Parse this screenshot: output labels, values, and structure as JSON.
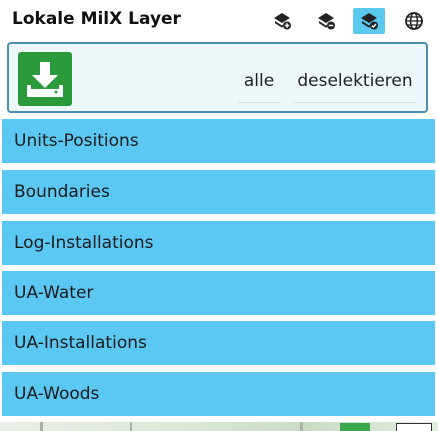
{
  "header": {
    "title": "Lokale MilX Layer",
    "icons": [
      "layers-add-icon",
      "layers-remove-icon",
      "layers-select-icon",
      "globe-icon"
    ],
    "active_icon": "layers-select-icon"
  },
  "toolbar": {
    "download_icon": "download-icon",
    "select_all_label": "alle",
    "deselect_label": "deselektieren"
  },
  "layers": [
    {
      "label": "Units-Positions"
    },
    {
      "label": "Boundaries"
    },
    {
      "label": "Log-Installations"
    },
    {
      "label": "UA-Water"
    },
    {
      "label": "UA-Installations"
    },
    {
      "label": "UA-Woods"
    }
  ],
  "colors": {
    "accent": "#5bc8f3",
    "download_button": "#2b9a3a",
    "toolbar_border": "#4a8fb0"
  }
}
